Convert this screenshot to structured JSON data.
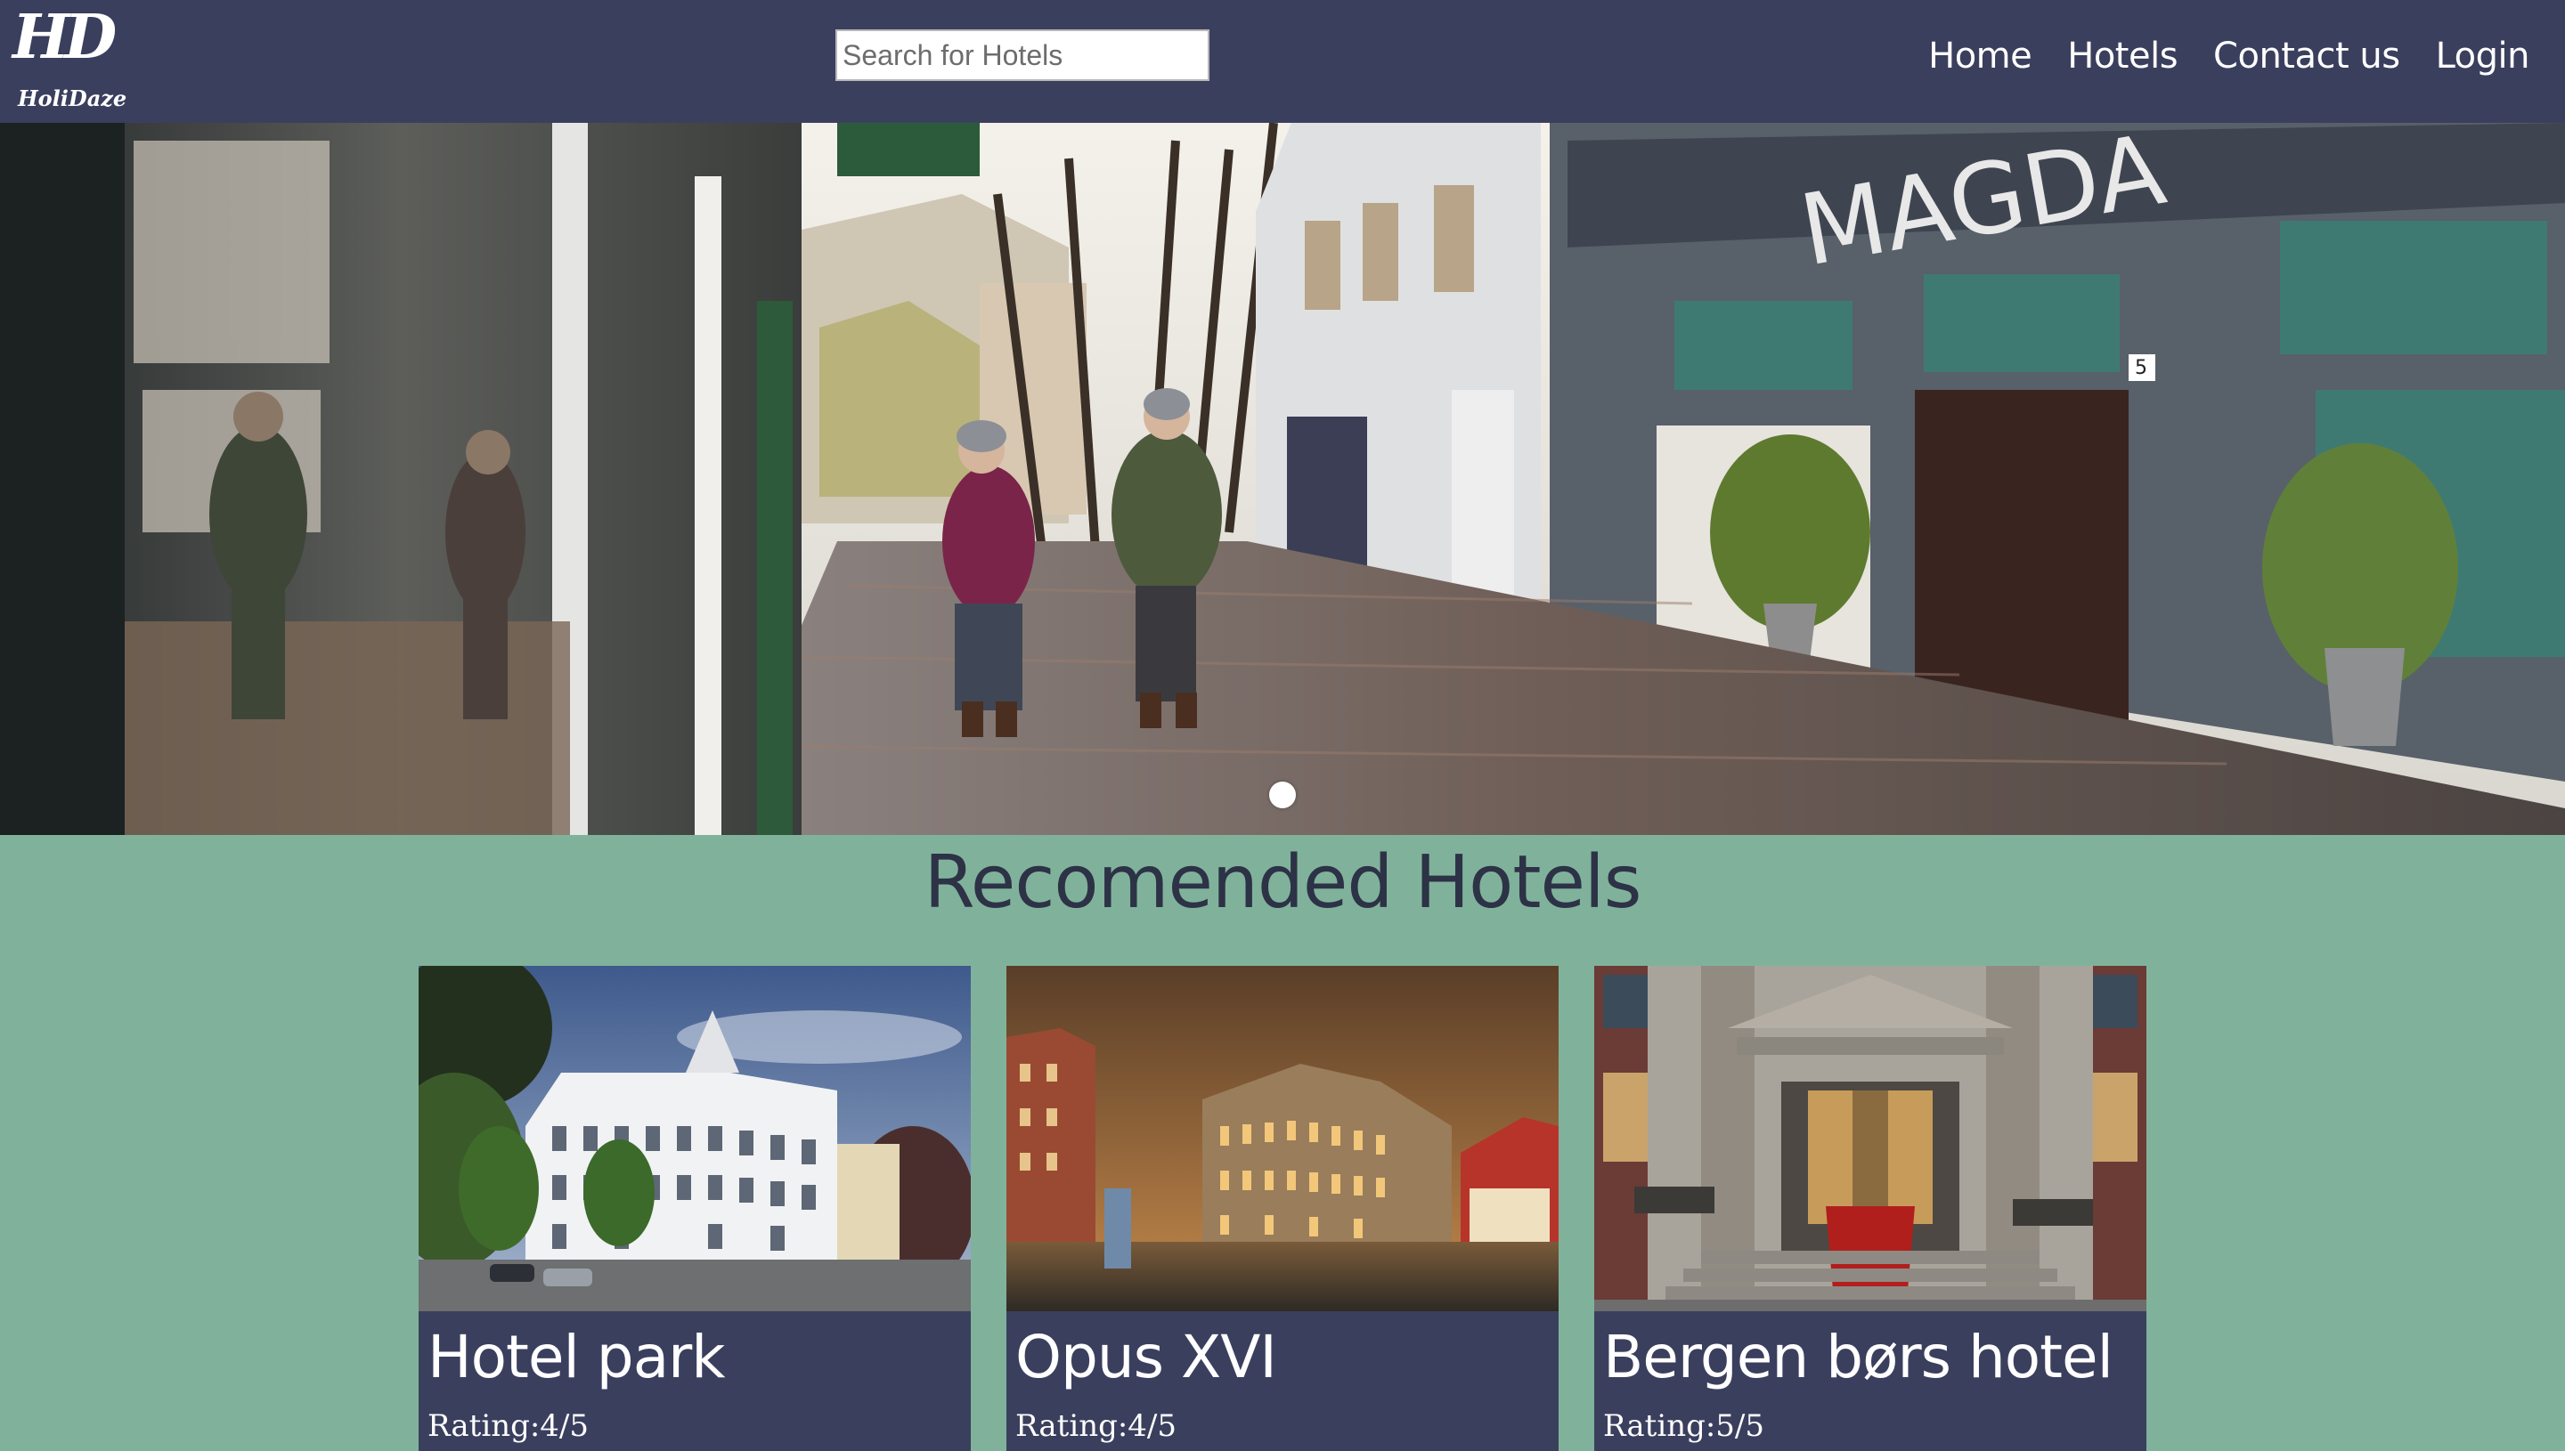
{
  "navbar": {
    "logo_mark": "HD",
    "logo_text": "HoliDaze",
    "search_placeholder": "Search for Hotels",
    "links": [
      {
        "label": "Home"
      },
      {
        "label": "Hotels"
      },
      {
        "label": "Contact us"
      },
      {
        "label": "Login"
      }
    ]
  },
  "hero": {
    "description": "Street scene with two people walking on a cobblestone street",
    "shop_sign": "MAGDA",
    "house_number": "5",
    "carousel_active_index": 0
  },
  "recommended": {
    "title": "Recomended Hotels",
    "hotels": [
      {
        "name": "Hotel park",
        "rating": "Rating:4/5"
      },
      {
        "name": "Opus XVI",
        "rating": "Rating:4/5"
      },
      {
        "name": "Bergen børs hotel",
        "rating": "Rating:5/5"
      }
    ]
  },
  "colors": {
    "navbar_bg": "#3b3f5e",
    "page_bg": "#80b29b",
    "card_bg": "#3b3f5e",
    "title_text": "#2d3246",
    "nav_text": "#ffffff"
  }
}
